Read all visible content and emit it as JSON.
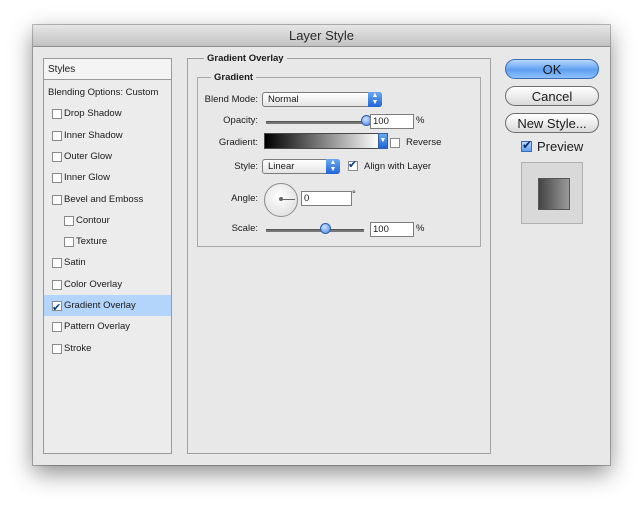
{
  "window": {
    "title": "Layer Style"
  },
  "sidebar": {
    "header": "Styles",
    "items": [
      {
        "label": "Blending Options: Custom",
        "checkbox": false,
        "checked": false,
        "indent": false,
        "selected": false
      },
      {
        "label": "Drop Shadow",
        "checkbox": true,
        "checked": false,
        "indent": false,
        "selected": false
      },
      {
        "label": "Inner Shadow",
        "checkbox": true,
        "checked": false,
        "indent": false,
        "selected": false
      },
      {
        "label": "Outer Glow",
        "checkbox": true,
        "checked": false,
        "indent": false,
        "selected": false
      },
      {
        "label": "Inner Glow",
        "checkbox": true,
        "checked": false,
        "indent": false,
        "selected": false
      },
      {
        "label": "Bevel and Emboss",
        "checkbox": true,
        "checked": false,
        "indent": false,
        "selected": false
      },
      {
        "label": "Contour",
        "checkbox": true,
        "checked": false,
        "indent": true,
        "selected": false
      },
      {
        "label": "Texture",
        "checkbox": true,
        "checked": false,
        "indent": true,
        "selected": false
      },
      {
        "label": "Satin",
        "checkbox": true,
        "checked": false,
        "indent": false,
        "selected": false
      },
      {
        "label": "Color Overlay",
        "checkbox": true,
        "checked": false,
        "indent": false,
        "selected": false
      },
      {
        "label": "Gradient Overlay",
        "checkbox": true,
        "checked": true,
        "indent": false,
        "selected": true
      },
      {
        "label": "Pattern Overlay",
        "checkbox": true,
        "checked": false,
        "indent": false,
        "selected": false
      },
      {
        "label": "Stroke",
        "checkbox": true,
        "checked": false,
        "indent": false,
        "selected": false
      }
    ]
  },
  "panel": {
    "title": "Gradient Overlay",
    "group_title": "Gradient",
    "blend_mode": {
      "label": "Blend Mode:",
      "value": "Normal"
    },
    "opacity": {
      "label": "Opacity:",
      "value": "100",
      "unit": "%",
      "level_percent": 100
    },
    "gradient": {
      "label": "Gradient:",
      "start_color": "#000000",
      "end_color": "#ffffff",
      "reverse_label": "Reverse",
      "reverse_checked": false
    },
    "style": {
      "label": "Style:",
      "value": "Linear",
      "align_label": "Align with Layer",
      "align_checked": true
    },
    "angle": {
      "label": "Angle:",
      "value": "0",
      "unit": "°"
    },
    "scale": {
      "label": "Scale:",
      "value": "100",
      "unit": "%",
      "level_percent": 60
    }
  },
  "buttons": {
    "ok": "OK",
    "cancel": "Cancel",
    "new_style": "New Style...",
    "preview_label": "Preview",
    "preview_checked": true
  },
  "colors": {
    "selection": "#b3d4fb",
    "accent": "#3d82e6"
  }
}
